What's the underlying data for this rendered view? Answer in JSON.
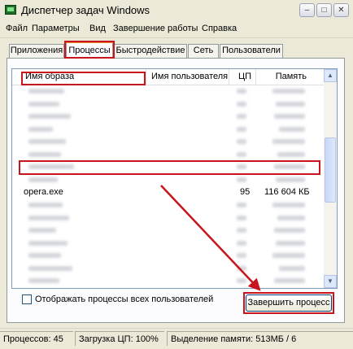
{
  "window": {
    "title": "Диспетчер задач Windows",
    "controls": {
      "minimize": "–",
      "maximize": "□",
      "close": "✕"
    }
  },
  "menu": [
    "Файл",
    "Параметры",
    "Вид",
    "Завершение работы",
    "Справка"
  ],
  "tabs": [
    {
      "label": "Приложения"
    },
    {
      "label": "Процессы",
      "active": true
    },
    {
      "label": "Быстродействие"
    },
    {
      "label": "Сеть"
    },
    {
      "label": "Пользователи"
    }
  ],
  "table": {
    "headers": {
      "image": "Имя образа",
      "user": "Имя пользователя",
      "cpu": "ЦП",
      "memory": "Память"
    },
    "highlighted_row": {
      "image": "opera.exe",
      "cpu": "95",
      "memory": "116 604 КБ"
    }
  },
  "scrollbar": {
    "up_icon": "up-arrow-icon",
    "down_icon": "down-arrow-icon"
  },
  "footer": {
    "show_all_label": "Отображать процессы всех пользователей",
    "end_process_label": "Завершить процесс"
  },
  "status": {
    "processes": "Процессов: 45",
    "cpu": "Загрузка ЦП: 100%",
    "memory": "Выделение памяти: 513МБ / 6"
  },
  "colors": {
    "highlight": "#c8151b",
    "accent_tab": "#e68b2c"
  }
}
